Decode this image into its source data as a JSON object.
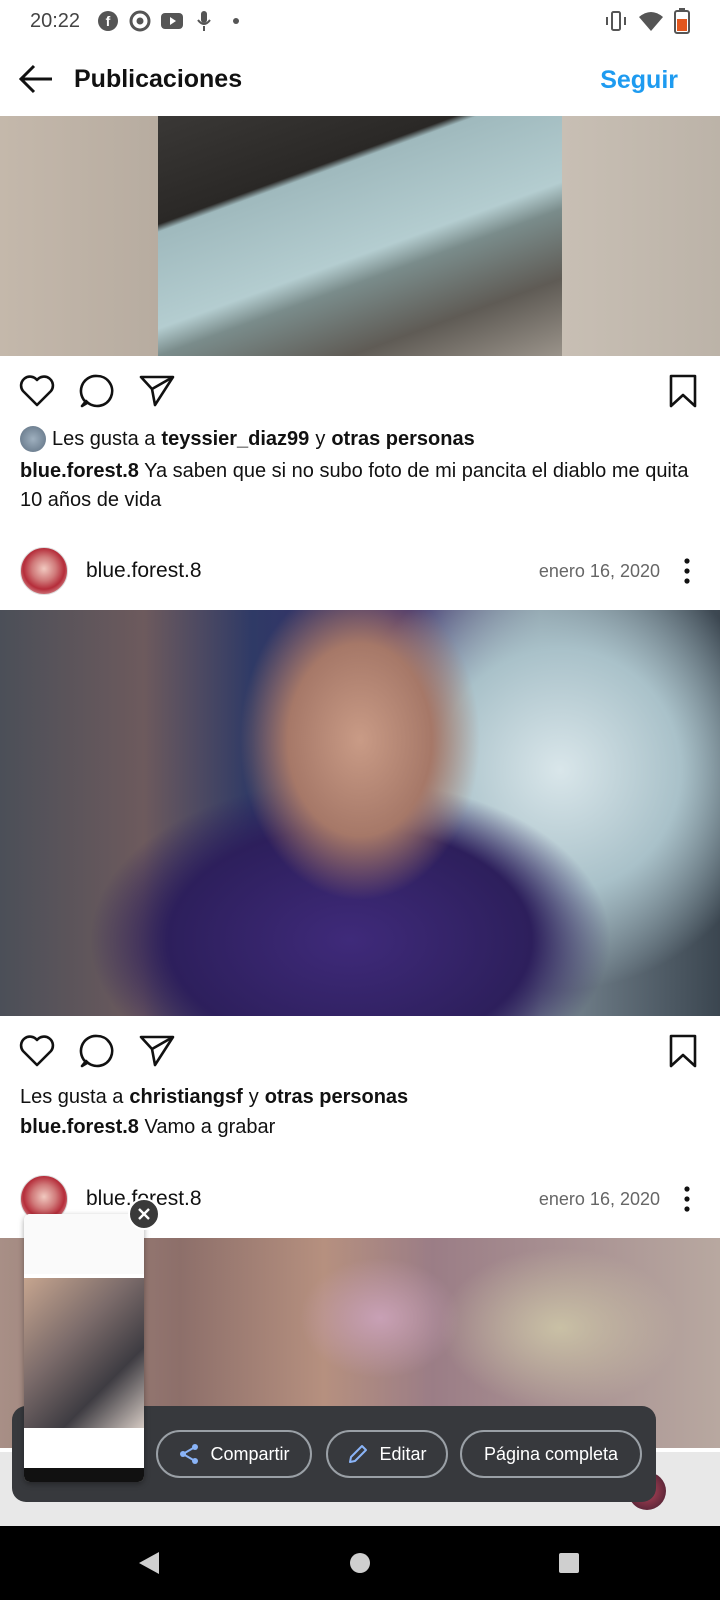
{
  "status_bar": {
    "time": "20:22",
    "icons_left": [
      "facebook-icon",
      "chrome-icon",
      "youtube-icon",
      "mic-icon",
      "dot-icon"
    ],
    "icons_right": [
      "vibrate-icon",
      "wifi-icon",
      "battery-icon"
    ]
  },
  "app_bar": {
    "title": "Publicaciones",
    "follow_label": "Seguir"
  },
  "posts": [
    {
      "likes_prefix": "Les gusta a",
      "liker": "teyssier_diaz99",
      "likes_joiner": "y",
      "likes_others": "otras personas",
      "author": "blue.forest.8",
      "caption": "Ya saben que si no subo foto de mi pancita el diablo me quita 10 años de vida"
    },
    {
      "author": "blue.forest.8",
      "date": "enero 16, 2020",
      "likes_prefix": "Les gusta a",
      "liker": "christiangsf",
      "likes_joiner": "y",
      "likes_others": "otras personas",
      "caption": "Vamo a grabar"
    },
    {
      "author": "blue.forest.8",
      "date": "enero 16, 2020"
    }
  ],
  "share_panel": {
    "share_label": "Compartir",
    "edit_label": "Editar",
    "full_page_label": "Página completa"
  },
  "colors": {
    "accent": "#1e9bf0",
    "panel_bg": "#37393d"
  }
}
